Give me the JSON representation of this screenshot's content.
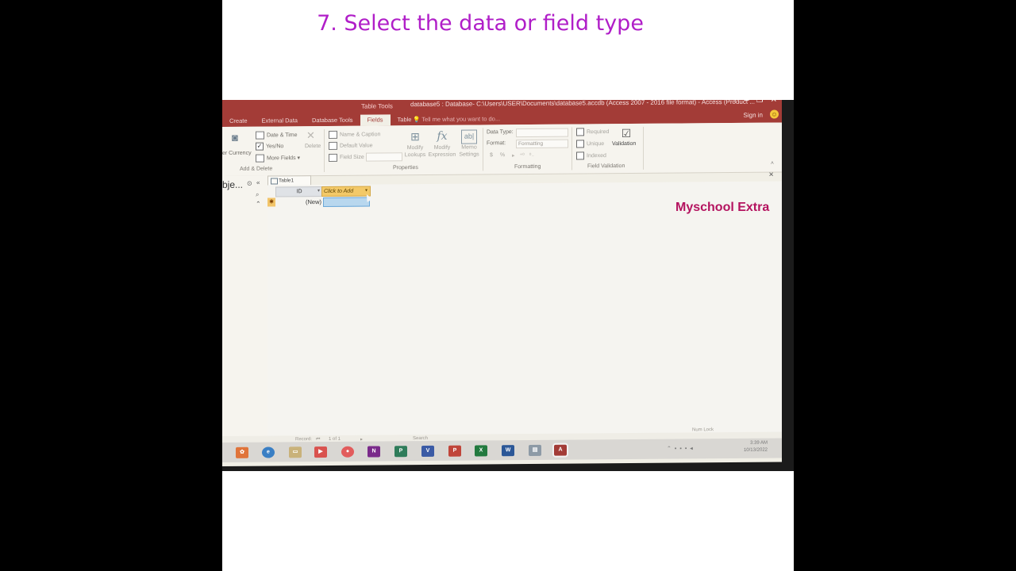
{
  "caption": "7. Select the data or field type",
  "watermark": "Myschool Extra",
  "window": {
    "context_label": "Table Tools",
    "title": "database5 : Database- C:\\Users\\USER\\Documents\\database5.accdb (Access 2007 - 2016 file format) - Access (Product ...",
    "controls": [
      "?",
      "–",
      "❐",
      "✕"
    ],
    "tell_me": "Tell me what you want to do...",
    "sign_in": "Sign in"
  },
  "tabs": [
    "Create",
    "External Data",
    "Database Tools",
    "Fields",
    "Table"
  ],
  "active_tab": "Fields",
  "ribbon": {
    "add_delete": {
      "currency_label": "er Currency",
      "date_time": "Date & Time",
      "yes_no": "Yes/No",
      "more_fields": "More Fields",
      "delete": "Delete",
      "group_label": "Add & Delete"
    },
    "properties": {
      "name_caption": "Name & Caption",
      "default_value": "Default Value",
      "field_size": "Field Size",
      "modify_lookups": "Modify Lookups",
      "modify_expression": "Modify Expression",
      "memo_settings": "Memo Settings",
      "group_label": "Properties"
    },
    "formatting": {
      "data_type": "Data Type:",
      "format": "Format:",
      "format_value": "Formatting",
      "currency_symbol": "$",
      "percent_symbol": "%",
      "group_label": "Formatting"
    },
    "validation": {
      "required": "Required",
      "unique": "Unique",
      "indexed": "Indexed",
      "validation": "Validation",
      "group_label": "Field Validation"
    }
  },
  "nav_pane": {
    "title": "bje..."
  },
  "table": {
    "tab_label": "Table1",
    "columns": [
      "ID",
      "Click to Add"
    ],
    "new_row": "(New)"
  },
  "record_nav": {
    "record_label": "Record:",
    "position": "1 of 1",
    "search": "Search"
  },
  "status": {
    "num_lock": "Num Lock"
  },
  "taskbar": {
    "clock_time": "3:39 AM",
    "clock_date": "10/13/2022",
    "icons": [
      {
        "letter": "N",
        "color": "#7a2a8a"
      },
      {
        "letter": "P",
        "color": "#2f7c5a"
      },
      {
        "letter": "V",
        "color": "#3b5ba5"
      },
      {
        "letter": "P",
        "color": "#c0453a"
      },
      {
        "letter": "X",
        "color": "#237a3f"
      },
      {
        "letter": "W",
        "color": "#2b5797"
      },
      {
        "letter": "A",
        "color": "#a33c37"
      }
    ]
  }
}
